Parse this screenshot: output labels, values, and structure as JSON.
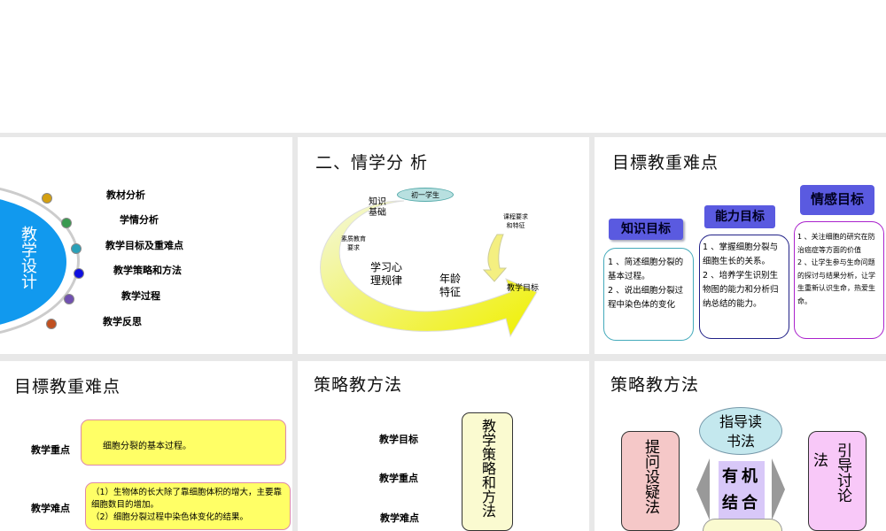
{
  "slides": [
    {
      "center": "教学设计",
      "items": [
        "教材分析",
        "学情分析",
        "教学目标及重难点",
        "教学策略和方法",
        "教学过程",
        "教学反思"
      ],
      "dot_colors": [
        "#d4a010",
        "#3a9a50",
        "#2aa0b8",
        "#1010e0",
        "#7050b0",
        "#c05020"
      ]
    },
    {
      "title": "二、情学分 析",
      "oval": "初一学生",
      "labels": [
        "知识",
        "基础",
        "素质教育",
        "要求",
        "学习心",
        "理规律",
        "年龄",
        "特征",
        "课程要求",
        "和特征",
        "教学目标"
      ]
    },
    {
      "title": "目標教重难点",
      "goals": [
        {
          "label": "知识目标",
          "lines": [
            "1 、简述细胞分裂的基本过程。",
            "2 、说出细胞分裂过程中染色体的变化"
          ]
        },
        {
          "label": "能力目标",
          "lines": [
            "1 、掌握细胞分裂与细胞生长的关系。",
            "2 、培养学生识别生物图的能力和分析归纳总结的能力。"
          ]
        },
        {
          "label": "情感目标",
          "lines": [
            "1 、关注细胞的研究在防治癌症等方面的价值",
            "2 、让学生参与生命问题的探讨与结果分析，让学生重新认识生命，热爱生命。"
          ]
        }
      ]
    },
    {
      "title": "目標教重难点",
      "key_label": "教学重点",
      "key_text": "细胞分裂的基本过程。",
      "hard_label": "教学难点",
      "hard_lines": [
        "（1）生物体的长大除了靠细胞体积的增大，主要靠细胞数目的增加。",
        "（2）细胞分裂过程中染色体变化的结果。"
      ]
    },
    {
      "title": "策略教方法",
      "rows": [
        "教学目标",
        "教学重点",
        "教学难点"
      ],
      "box": "教学策略和方法"
    },
    {
      "title": "策略教方法",
      "top": "指导读书法",
      "left": "提问设疑法",
      "right": "引导讨论",
      "right_extra": "法",
      "center": "有机结合"
    }
  ]
}
